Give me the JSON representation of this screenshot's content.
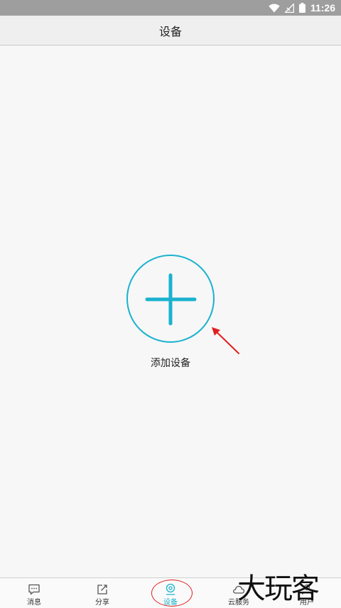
{
  "status_bar": {
    "time": "11:26",
    "icons": [
      "wifi-icon",
      "no-signal-icon",
      "battery-icon"
    ]
  },
  "header": {
    "title": "设备"
  },
  "main": {
    "add_device": {
      "icon": "plus-icon",
      "label": "添加设备",
      "accent_color": "#1ab2cf"
    }
  },
  "annotation": {
    "arrow_color": "#e02020"
  },
  "tab_bar": {
    "items": [
      {
        "label": "消息",
        "icon": "message-icon"
      },
      {
        "label": "分享",
        "icon": "share-icon"
      },
      {
        "label": "设备",
        "icon": "camera-icon",
        "active": true
      },
      {
        "label": "云服务",
        "icon": "cloud-icon"
      },
      {
        "label": "用户",
        "icon": "user-icon"
      }
    ]
  },
  "watermark": {
    "text": "大玩客"
  }
}
